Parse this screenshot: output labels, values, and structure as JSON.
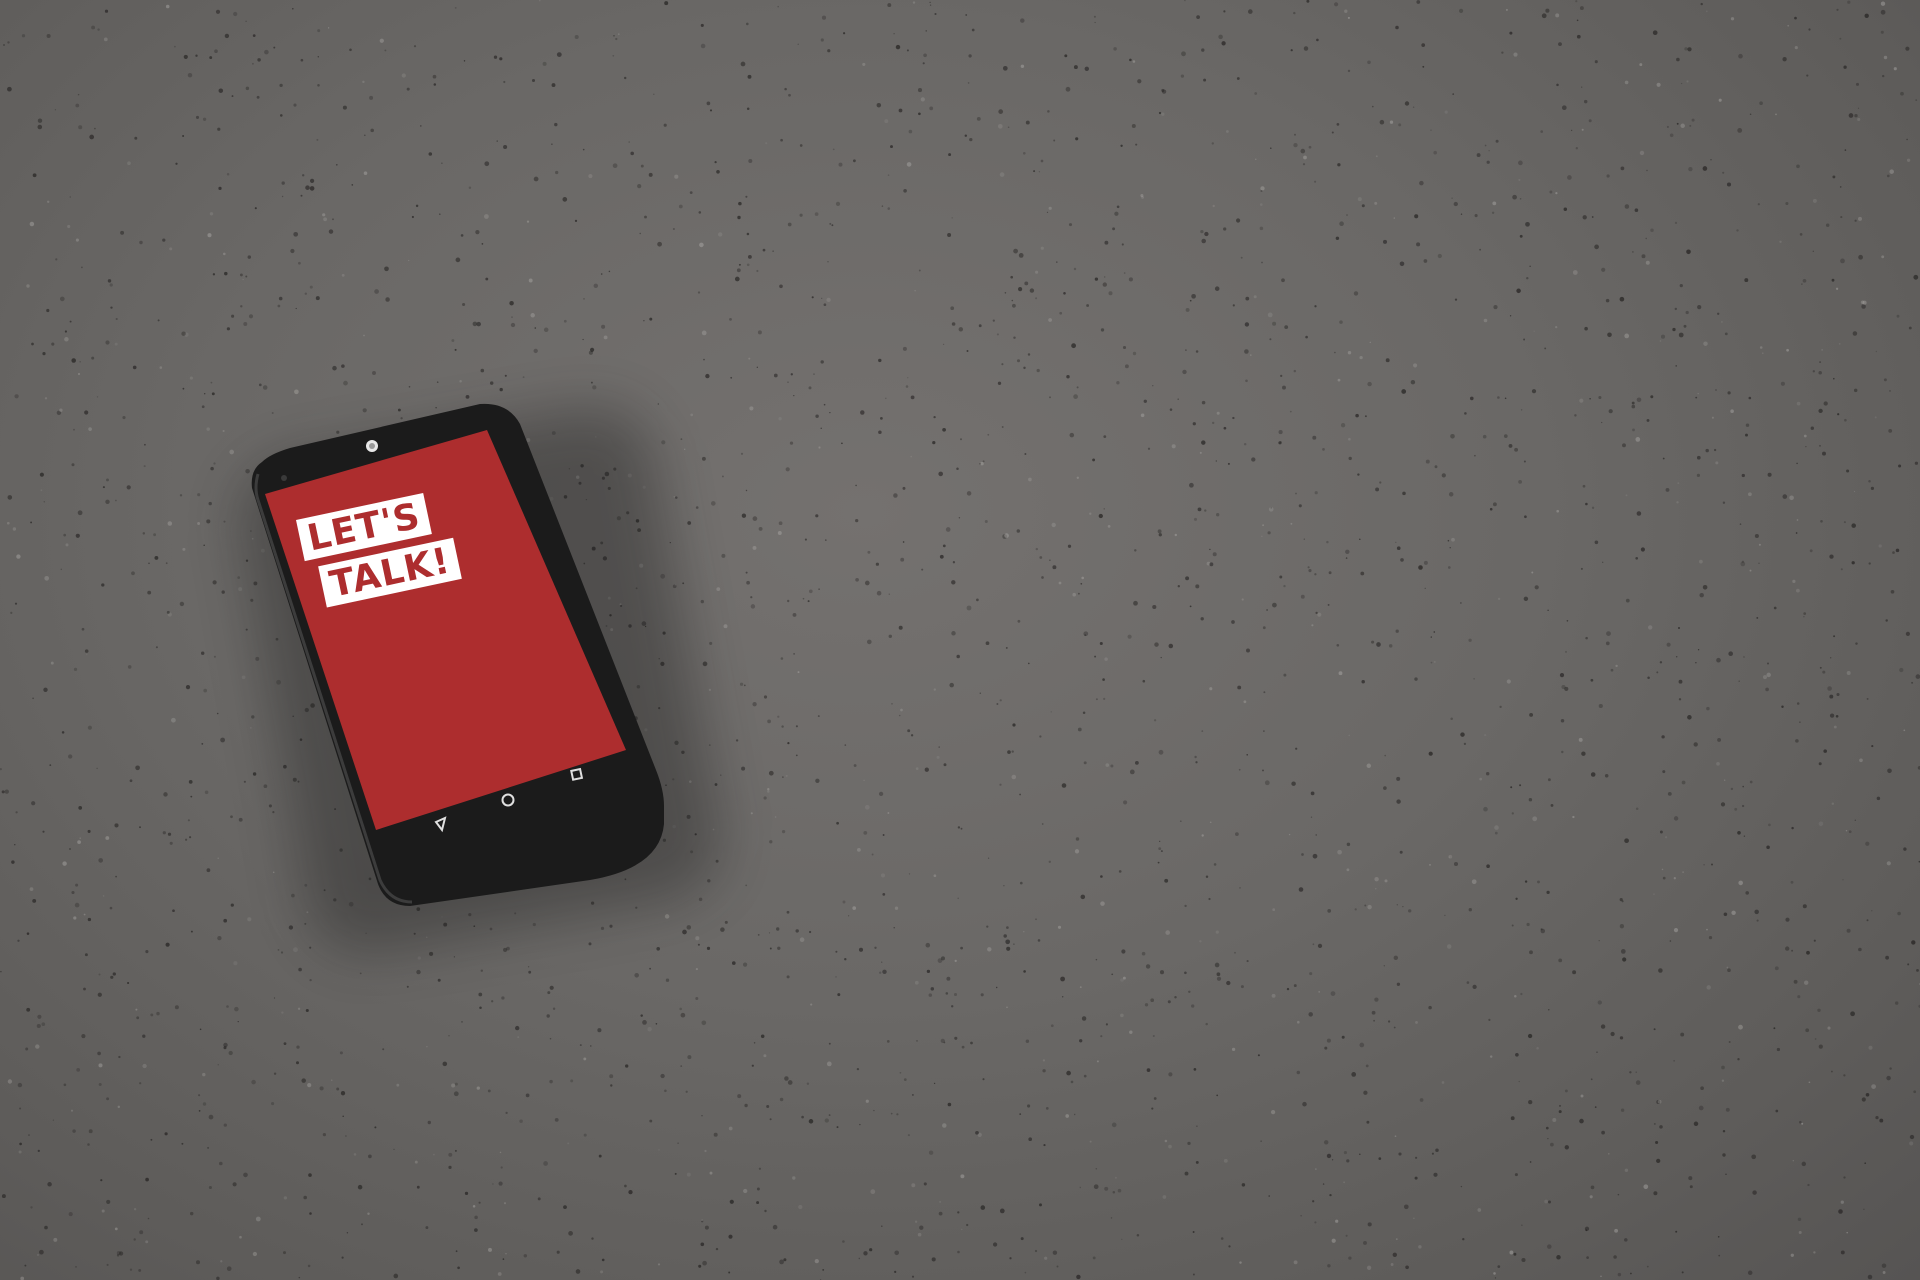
{
  "scene": {
    "surface_color": "#6a6866",
    "phone_body_color": "#1c1c1c",
    "screen_color": "#ad2d2e"
  },
  "phone_screen": {
    "logo_line_1": "LET'S",
    "logo_line_2": "TALK!",
    "logo_bg_color": "#ffffff",
    "logo_text_color": "#ad2d2e"
  },
  "nav_bar": {
    "back_icon": "back-triangle-icon",
    "home_icon": "home-circle-icon",
    "recents_icon": "recents-square-icon"
  }
}
